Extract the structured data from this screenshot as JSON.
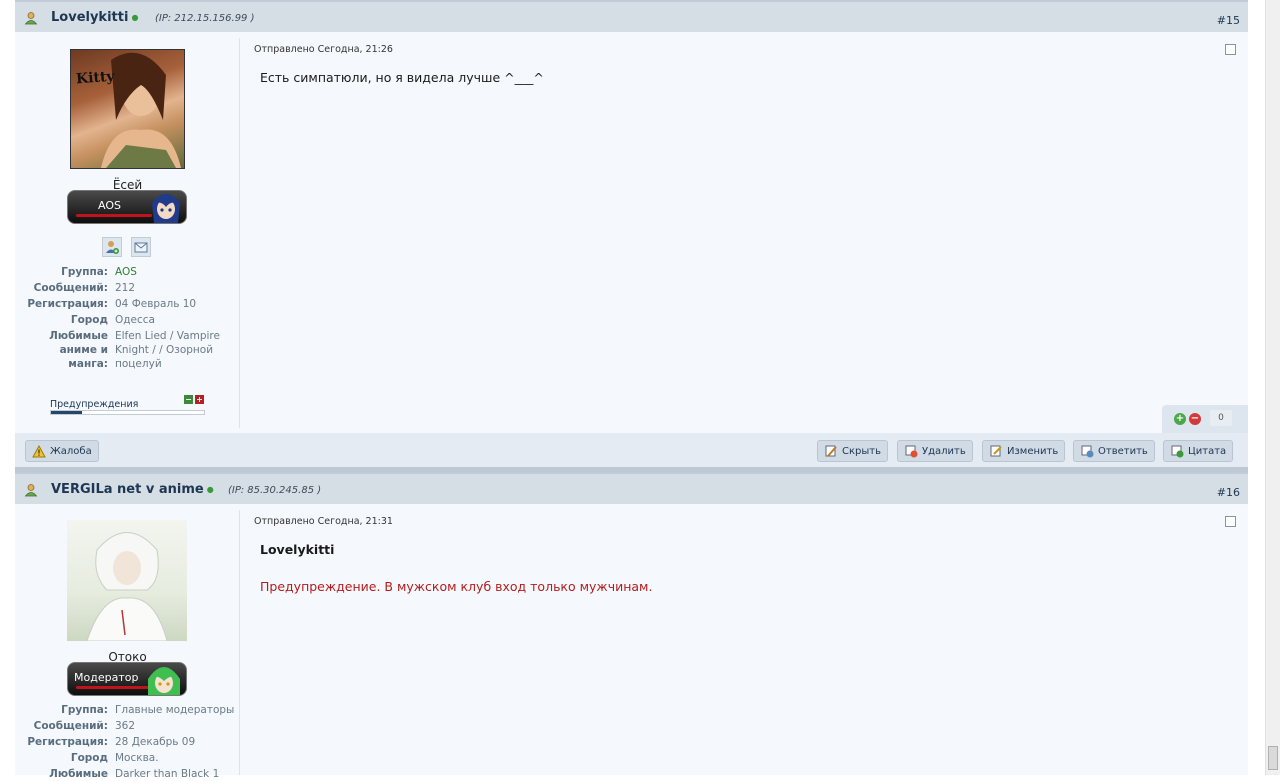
{
  "posts": [
    {
      "author": "Lovelykitti",
      "ip": "(IP: 212.15.156.99 )",
      "number": "#15",
      "avatar_text": "Kitty",
      "user_title": "Ёсей",
      "rank_label": "AOS",
      "info": [
        {
          "label": "Группа:",
          "value": "AOS"
        },
        {
          "label": "Сообщений:",
          "value": "212"
        },
        {
          "label": "Регистрация:",
          "value": "04 Февраль 10"
        },
        {
          "label": "Город",
          "value": "Одесса"
        },
        {
          "label": "Любимые аниме и манга:",
          "value": "Elfen Lied / Vampire Knight / / Озорной поцелуй"
        }
      ],
      "warnings_label": "Предупреждения",
      "warnings_level": 0.2,
      "posted": "Отправлено Сегодна, 21:26",
      "content": "Есть симпатюли, но я видела лучше ^___^",
      "rating": "0",
      "report_label": "Жалоба",
      "actions": [
        "Скрыть",
        "Удалить",
        "Изменить",
        "Ответить",
        "Цитата"
      ]
    },
    {
      "author": "VERGILa net v anime",
      "ip": "(IP: 85.30.245.85 )",
      "number": "#16",
      "user_title": "Отоко",
      "rank_label": "Модератор",
      "info": [
        {
          "label": "Группа:",
          "value": "Главные модераторы"
        },
        {
          "label": "Сообщений:",
          "value": "362"
        },
        {
          "label": "Регистрация:",
          "value": "28 Декабрь 09"
        },
        {
          "label": "Город",
          "value": "Москва."
        },
        {
          "label": "Любимые",
          "value": "Darker than Black 1"
        }
      ],
      "posted": "Отправлено Сегодна, 21:31",
      "quote_name": "Lovelykitti",
      "warning": "Предупреждение. В мужском клуб вход только мужчинам."
    }
  ],
  "colors": {
    "header_bg": "#d5dde5",
    "body_bg": "#f5f9fd",
    "link": "#1d3652",
    "warning_red": "#b51c1c",
    "group_green": "#2e7d32"
  },
  "icons": [
    "user-icon",
    "profile-link-icon",
    "add-friend-icon",
    "message-icon",
    "rate-up-icon",
    "rate-down-icon",
    "warning-triangle-icon",
    "hide-icon",
    "delete-icon",
    "edit-icon",
    "reply-icon",
    "quote-icon"
  ]
}
